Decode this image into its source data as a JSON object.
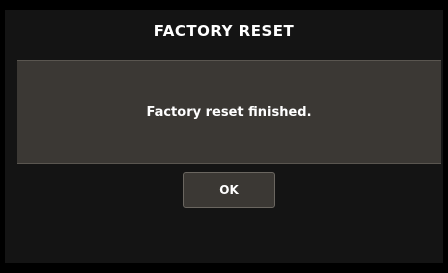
{
  "dialog": {
    "title": "FACTORY RESET",
    "message": "Factory reset finished.",
    "ok_label": "OK"
  },
  "colors": {
    "background": "#000000",
    "dialog_background": "#141414",
    "panel_background": "#3b3834",
    "text": "#ffffff"
  }
}
